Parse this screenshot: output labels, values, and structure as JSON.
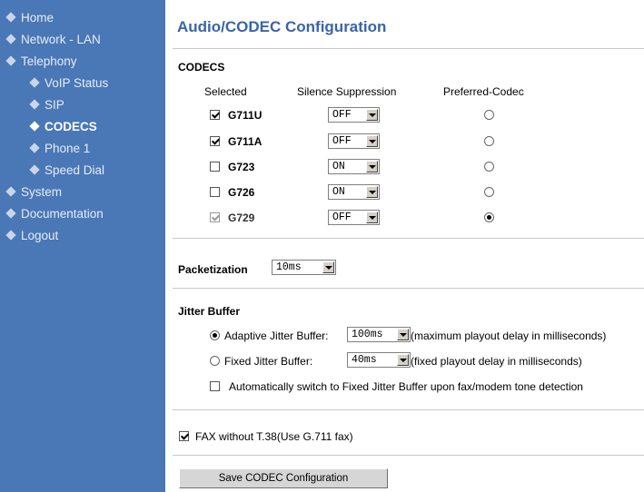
{
  "sidebar": {
    "items": [
      {
        "label": "Home"
      },
      {
        "label": "Network - LAN"
      },
      {
        "label": "Telephony"
      },
      {
        "label": "VoIP Status"
      },
      {
        "label": "SIP"
      },
      {
        "label": "CODECS"
      },
      {
        "label": "Phone 1"
      },
      {
        "label": "Speed Dial"
      },
      {
        "label": "System"
      },
      {
        "label": "Documentation"
      },
      {
        "label": "Logout"
      }
    ]
  },
  "page_title": "Audio/CODEC Configuration",
  "codecs": {
    "heading": "CODECS",
    "col_selected": "Selected",
    "col_silence": "Silence Suppression",
    "col_preferred": "Preferred-Codec",
    "rows": [
      {
        "name": "G711U",
        "selected": true,
        "silence": "OFF",
        "preferred": false,
        "disabled": false
      },
      {
        "name": "G711A",
        "selected": true,
        "silence": "OFF",
        "preferred": false,
        "disabled": false
      },
      {
        "name": "G723",
        "selected": false,
        "silence": "ON",
        "preferred": false,
        "disabled": false
      },
      {
        "name": "G726",
        "selected": false,
        "silence": "ON",
        "preferred": false,
        "disabled": false
      },
      {
        "name": "G729",
        "selected": true,
        "silence": "OFF",
        "preferred": true,
        "disabled": true
      }
    ]
  },
  "packetization": {
    "label": "Packetization",
    "value": "10ms"
  },
  "jitter": {
    "heading": "Jitter Buffer",
    "adaptive_label": "Adaptive Jitter Buffer:",
    "adaptive_value": "100ms",
    "adaptive_note": "(maximum playout delay in milliseconds)",
    "adaptive_checked": true,
    "fixed_label": "Fixed Jitter Buffer:",
    "fixed_value": "40ms",
    "fixed_note": "(fixed playout delay in milliseconds)",
    "fixed_checked": false,
    "auto_switch_label": "Automatically switch to Fixed Jitter Buffer upon fax/modem tone detection",
    "auto_switch_checked": false
  },
  "fax": {
    "label": "FAX without T.38(Use G.711 fax)",
    "checked": true
  },
  "save_button": "Save CODEC Configuration",
  "colors": {
    "sidebar_bg": "#4a77b6",
    "title": "#3a64a8"
  }
}
